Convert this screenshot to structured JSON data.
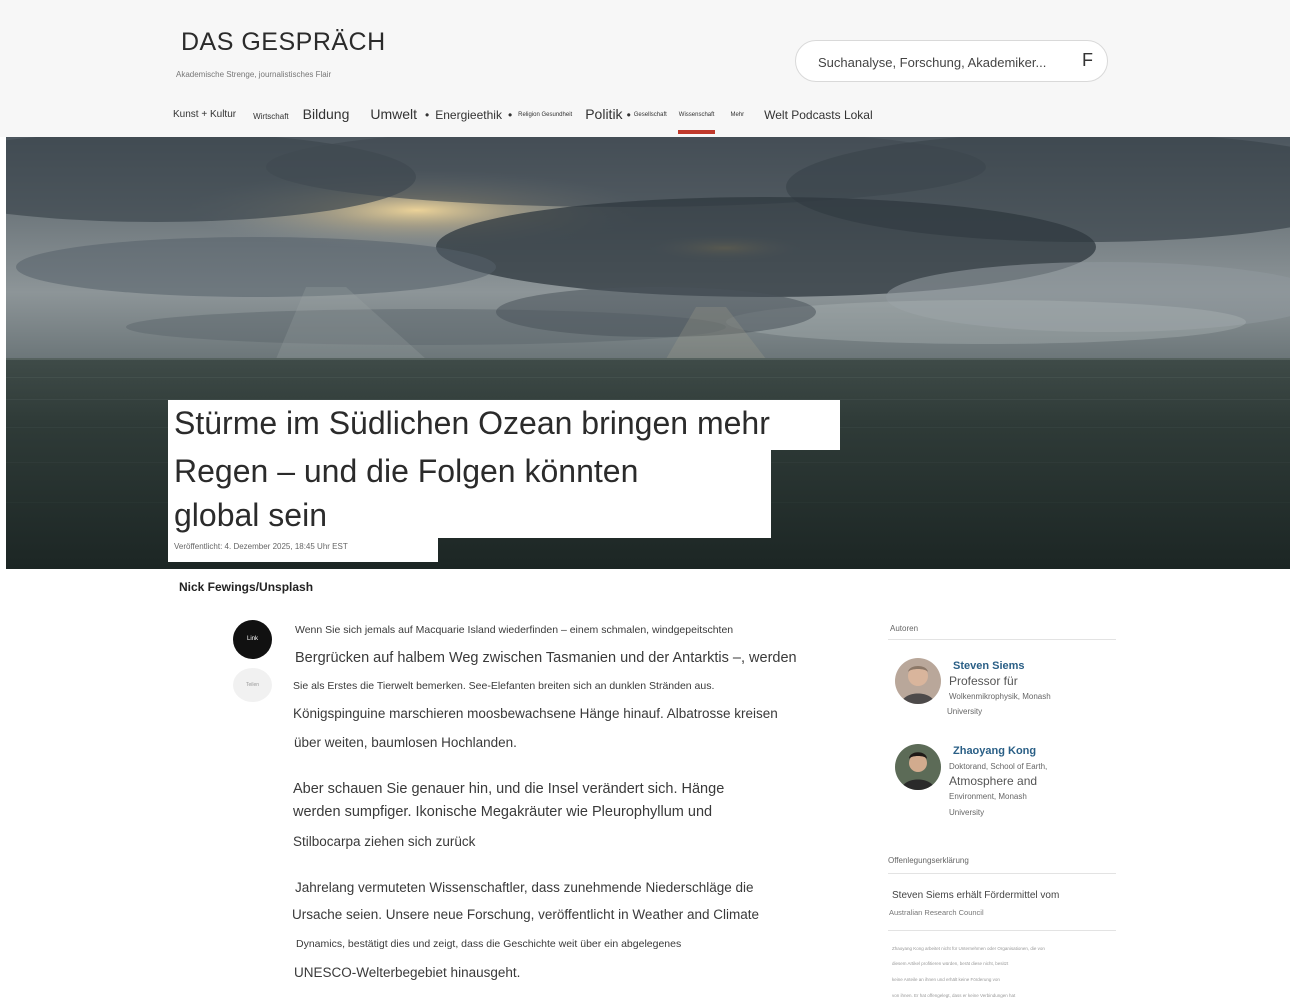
{
  "site": {
    "name": "DAS GESPRÄCH",
    "tagline": "Akademische Strenge, journalistisches Flair"
  },
  "search": {
    "placeholder": "Suchanalyse, Forschung, Akademiker...",
    "button_label": "F"
  },
  "nav": {
    "items": [
      {
        "label": "Kunst + Kultur"
      },
      {
        "label": "Wirtschaft"
      },
      {
        "label": "Bildung"
      },
      {
        "label": "Umwelt"
      },
      {
        "label": "Energieethik"
      },
      {
        "label": "Religion Gesundheit"
      },
      {
        "label": "Politik"
      },
      {
        "label": "Gesellschaft"
      },
      {
        "label": "Wissenschaft"
      },
      {
        "label": "Mehr"
      },
      {
        "label": "Welt Podcasts Lokal"
      }
    ],
    "active_index": 8,
    "accent_color": "#c0392b"
  },
  "article": {
    "headline_lines": [
      "Stürme im Südlichen Ozean bringen mehr",
      "Regen – und die Folgen könnten",
      "global sein"
    ],
    "published": "Veröffentlicht: 4. Dezember 2025, 18:45 Uhr EST",
    "image_credit": "Nick Fewings/Unsplash",
    "share_labels": [
      "Link",
      "Teilen"
    ],
    "paragraphs": [
      {
        "lines": [
          "Wenn Sie sich jemals auf Macquarie Island wiederfinden – einem schmalen, windgepeitschten",
          "Bergrücken auf halbem Weg zwischen Tasmanien und der Antarktis –, werden",
          "Sie als Erstes die Tierwelt bemerken. See-Elefanten breiten sich an dunklen Stränden aus.",
          "Königspinguine marschieren moosbewachsene Hänge hinauf. Albatrosse kreisen",
          "über weiten, baumlosen Hochlanden."
        ]
      },
      {
        "lines": [
          "Aber schauen Sie genauer hin, und die Insel verändert sich. Hänge",
          "werden sumpfiger. Ikonische Megakräuter wie Pleurophyllum und",
          "Stilbocarpa ziehen sich zurück"
        ]
      },
      {
        "lines": [
          "Jahrelang vermuteten Wissenschaftler, dass zunehmende Niederschläge die",
          "Ursache seien. Unsere neue Forschung, veröffentlicht in Weather and Climate",
          "Dynamics, bestätigt dies und zeigt, dass die Geschichte weit über ein abgelegenes",
          "UNESCO-Welterbegebiet hinausgeht."
        ]
      }
    ]
  },
  "sidebar": {
    "authors_label": "Autoren",
    "authors": [
      {
        "name": "Steven Siems",
        "title": "Professor für",
        "detail_lines": [
          "Wolkenmikrophysik, Monash",
          "University"
        ]
      },
      {
        "name": "Zhaoyang Kong",
        "title": "Atmosphere and",
        "detail_lines": [
          "Doktorand, School of Earth,",
          "Environment, Monash",
          "University"
        ]
      }
    ],
    "disclosure_label": "Offenlegungserklärung",
    "disclosure_text": "Steven Siems erhält Fördermittel vom",
    "disclosure_org": "Australian Research Council",
    "fine_print": [
      "Zhaoyang Kong arbeitet nicht für Unternehmen oder Organisationen, die von",
      "diesem Artikel profitieren würden, berät diese nicht, besitzt",
      "keine Anteile an ihnen und erhält keine Förderung von",
      "von ihnen. Er hat offengelegt, dass er keine Verbindungen hat"
    ]
  },
  "colors": {
    "header_bg": "#f7f7f7",
    "accent": "#c0392b",
    "author_link": "#2a5f86"
  }
}
